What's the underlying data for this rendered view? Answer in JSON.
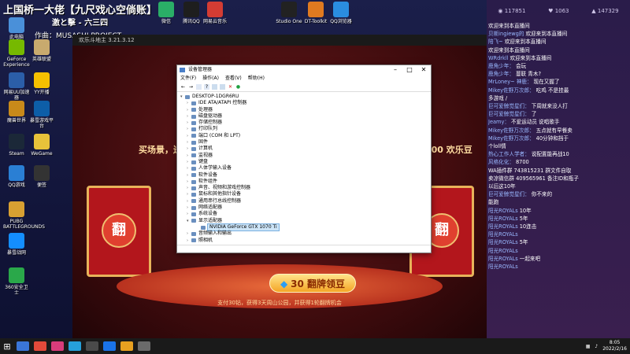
{
  "stream": {
    "title": "上国桥一大佬【九尺戏心空倘账】",
    "line2": "激と擊 - 六三四",
    "line3": "作曲：MUSASHI PROJECT"
  },
  "desktop_icons": [
    {
      "label": "此电脑",
      "color": "#4a90d9"
    },
    {
      "label": "GeForce Experience",
      "color": "#76b900"
    },
    {
      "label": "网易UU加速器",
      "color": "#2b5ea8"
    },
    {
      "label": "魔兽世界",
      "color": "#c88a1a"
    },
    {
      "label": "Steam",
      "color": "#1b2838"
    },
    {
      "label": "QQ游戏",
      "color": "#2a7fd4"
    },
    {
      "label": "PUBG BATTLEGROUNDS",
      "color": "#d8a032"
    },
    {
      "label": "暴雪战网",
      "color": "#148eff"
    },
    {
      "label": "360安全卫士",
      "color": "#2aa84a"
    },
    {
      "label": "英雄联盟",
      "color": "#c8aa6e"
    },
    {
      "label": "YY开播",
      "color": "#f5c000"
    },
    {
      "label": "暴雪游戏平台",
      "color": "#0d5ea8"
    },
    {
      "label": "WeGame",
      "color": "#e8c23a"
    },
    {
      "label": "便签",
      "color": "#333333"
    }
  ],
  "top_icons": [
    {
      "label": "微信",
      "color": "#2aae67"
    },
    {
      "label": "腾讯QQ",
      "color": "#1e1e1e"
    },
    {
      "label": "网易云音乐",
      "color": "#d43c33"
    },
    {
      "label": "Studio One",
      "color": "#222222"
    },
    {
      "label": "DT-Toolkit",
      "color": "#e07a20"
    },
    {
      "label": "QQ浏览器",
      "color": "#2a8de0"
    }
  ],
  "game": {
    "window_title": "欢乐斗地主 3.21.3.12",
    "text_left": "买场景，送",
    "text_right": "000 欢乐豆",
    "card_label": "翻",
    "cta": "30 翻牌领豆",
    "footer": "支付30钻，获得3天周山公园，并获得1轮翻牌机会"
  },
  "devmgr": {
    "title": "设备管理器",
    "menu": [
      "文件(F)",
      "操作(A)",
      "查看(V)",
      "帮助(H)"
    ],
    "tree": [
      {
        "label": "DESKTOP-1DGR6RU",
        "level": 0,
        "arrow": "▾"
      },
      {
        "label": "IDE ATA/ATAPI 控制器",
        "level": 1,
        "arrow": "›"
      },
      {
        "label": "处理器",
        "level": 1,
        "arrow": "›"
      },
      {
        "label": "磁盘驱动器",
        "level": 1,
        "arrow": "›"
      },
      {
        "label": "存储控制器",
        "level": 1,
        "arrow": "›"
      },
      {
        "label": "打印队列",
        "level": 1,
        "arrow": "›"
      },
      {
        "label": "端口 (COM 和 LPT)",
        "level": 1,
        "arrow": "›"
      },
      {
        "label": "固件",
        "level": 1,
        "arrow": "›"
      },
      {
        "label": "计算机",
        "level": 1,
        "arrow": "›"
      },
      {
        "label": "监视器",
        "level": 1,
        "arrow": "›"
      },
      {
        "label": "键盘",
        "level": 1,
        "arrow": "›"
      },
      {
        "label": "人体学输入设备",
        "level": 1,
        "arrow": "›"
      },
      {
        "label": "软件设备",
        "level": 1,
        "arrow": "›"
      },
      {
        "label": "软件组件",
        "level": 1,
        "arrow": "›"
      },
      {
        "label": "声音、视频和游戏控制器",
        "level": 1,
        "arrow": "›"
      },
      {
        "label": "鼠标和其他指针设备",
        "level": 1,
        "arrow": "›"
      },
      {
        "label": "通用串行总线控制器",
        "level": 1,
        "arrow": "›"
      },
      {
        "label": "网络适配器",
        "level": 1,
        "arrow": "›"
      },
      {
        "label": "系统设备",
        "level": 1,
        "arrow": "›"
      },
      {
        "label": "显示适配器",
        "level": 1,
        "arrow": "▾"
      },
      {
        "label": "NVIDIA GeForce GTX 1070 Ti",
        "level": 2,
        "arrow": "",
        "selected": true
      },
      {
        "label": "音频输入和输出",
        "level": 1,
        "arrow": "›"
      },
      {
        "label": "照相机",
        "level": 1,
        "arrow": "›"
      }
    ]
  },
  "chat": {
    "stats": [
      "117851",
      "1063",
      "147329"
    ],
    "messages": [
      {
        "badge": "",
        "user": "",
        "text": "欢迎来到本直播间"
      },
      {
        "badge": "",
        "user": "贝斯ingiewg的",
        "text": "欢迎来到本直播间"
      },
      {
        "badge": "",
        "user": "陪飞~",
        "text": "欢迎来到本直播间"
      },
      {
        "badge": "",
        "user": "",
        "text": "欢迎来到本直播间"
      },
      {
        "badge": "",
        "user": "WRdrkll",
        "text": "欢迎来到本直播间"
      },
      {
        "badge": "",
        "user": "鹿角少年：",
        "text": "会玩"
      },
      {
        "badge": "",
        "user": "鹿角少年：",
        "text": "蔓联 青木?"
      },
      {
        "badge": "",
        "user": "MrLoney~ 神鹿：",
        "text": "现在又握了"
      },
      {
        "badge": "",
        "user": "Mikey佐野万次郎：",
        "text": "吃鸡 不是挂最"
      },
      {
        "badge": "",
        "user": "",
        "text": "多游戏 /"
      },
      {
        "badge": "",
        "user": "巨可爱鲸觉星们：",
        "text": "下周就来没人打"
      },
      {
        "badge": "",
        "user": "巨可爱鲸觉星们：",
        "text": "了"
      },
      {
        "badge": "",
        "user": "Jeamy：",
        "text": "不爱运动员 说唱歌手"
      },
      {
        "badge": "",
        "user": "Mikey佐野万次郎：",
        "text": "五点就有早餐卖"
      },
      {
        "badge": "",
        "user": "Mikey佐野万次郎：",
        "text": "40分钟和挡于"
      },
      {
        "badge": "",
        "user": "",
        "text": "个loll情"
      },
      {
        "badge": "",
        "user": "热心工作人学者：",
        "text": "说配置能再战10"
      },
      {
        "badge": "",
        "user": "风格化化：",
        "text": "8700"
      },
      {
        "badge": "",
        "user": "",
        "text": "WA插件群 743815231 群文件自取"
      },
      {
        "badge": "",
        "user": "",
        "text": "卖凉微信群 409565961 备注ID和瓶子"
      },
      {
        "badge": "",
        "user": "",
        "text": "以后这10年"
      },
      {
        "badge": "",
        "user": "巨可爱鲸觉星们：",
        "text": "你不来的"
      },
      {
        "badge": "",
        "user": "",
        "text": "能跑"
      },
      {
        "badge": "",
        "user": "阳光ROYALs",
        "text": "10年"
      },
      {
        "badge": "",
        "user": "阳光ROYALs",
        "text": "5年"
      },
      {
        "badge": "",
        "user": "阳光ROYALs",
        "text": "10连击"
      },
      {
        "badge": "",
        "user": "阳光ROYALs",
        "text": ""
      },
      {
        "badge": "",
        "user": "阳光ROYALs",
        "text": "5年"
      },
      {
        "badge": "",
        "user": "阳光ROYALs",
        "text": ""
      },
      {
        "badge": "",
        "user": "阳光ROYALs",
        "text": "一起来吧"
      },
      {
        "badge": "",
        "user": "阳光ROYALs",
        "text": ""
      }
    ]
  },
  "taskbar": {
    "start_glyph": "⊞",
    "apps": [
      "#3a76d8",
      "#e34a3a",
      "#d83c7a",
      "#26a0da",
      "#4a4a4a",
      "#1a73e8",
      "#e8a020",
      "#6a6a6a"
    ],
    "time": "8:05",
    "date": "2022/2/16"
  }
}
